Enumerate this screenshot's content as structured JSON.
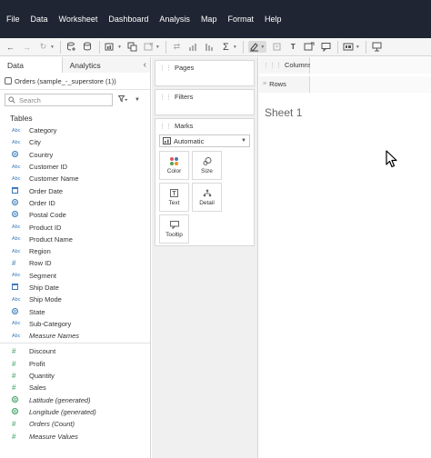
{
  "menu": [
    "File",
    "Data",
    "Worksheet",
    "Dashboard",
    "Analysis",
    "Map",
    "Format",
    "Help"
  ],
  "toolbar_icons": [
    "back-icon",
    "forward-icon",
    "redo-icon",
    "new-datasource-icon",
    "pause-icon",
    "new-worksheet-icon",
    "duplicate-icon",
    "clear-icon",
    "swap-icon",
    "sort-asc-icon",
    "sort-desc-icon",
    "totals-icon",
    "highlight-icon",
    "group-icon",
    "labels-icon",
    "fix-axes-icon",
    "tooltip-icon",
    "fit-icon",
    "show-me-icon",
    "present-icon"
  ],
  "data_pane": {
    "tab_data": "Data",
    "tab_analytics": "Analytics",
    "collapse_glyph": "‹",
    "datasource": "Orders (sample_-_superstore (1))",
    "search_placeholder": "Search",
    "tables_label": "Tables",
    "dimensions": [
      {
        "name": "Category",
        "type": "Abc"
      },
      {
        "name": "City",
        "type": "Abc"
      },
      {
        "name": "Country",
        "type": "globe"
      },
      {
        "name": "Customer ID",
        "type": "Abc"
      },
      {
        "name": "Customer Name",
        "type": "Abc"
      },
      {
        "name": "Order Date",
        "type": "date"
      },
      {
        "name": "Order ID",
        "type": "globe"
      },
      {
        "name": "Postal Code",
        "type": "globe"
      },
      {
        "name": "Product ID",
        "type": "Abc"
      },
      {
        "name": "Product Name",
        "type": "Abc"
      },
      {
        "name": "Region",
        "type": "Abc"
      },
      {
        "name": "Row ID",
        "type": "#"
      },
      {
        "name": "Segment",
        "type": "Abc"
      },
      {
        "name": "Ship Date",
        "type": "date"
      },
      {
        "name": "Ship Mode",
        "type": "Abc"
      },
      {
        "name": "State",
        "type": "globe"
      },
      {
        "name": "Sub-Category",
        "type": "Abc"
      },
      {
        "name": "Measure Names",
        "type": "Abc"
      }
    ],
    "measures": [
      {
        "name": "Discount",
        "type": "#"
      },
      {
        "name": "Profit",
        "type": "#"
      },
      {
        "name": "Quantity",
        "type": "#"
      },
      {
        "name": "Sales",
        "type": "#"
      },
      {
        "name": "Latitude (generated)",
        "type": "globe"
      },
      {
        "name": "Longitude (generated)",
        "type": "globe"
      },
      {
        "name": "Orders (Count)",
        "type": "#"
      },
      {
        "name": "Measure Values",
        "type": "#"
      }
    ]
  },
  "shelves": {
    "pages": "Pages",
    "filters": "Filters",
    "marks": "Marks",
    "mark_type": "Automatic",
    "mark_buttons": [
      "Color",
      "Size",
      "Text",
      "Detail",
      "Tooltip"
    ],
    "columns": "Columns",
    "rows": "Rows"
  },
  "sheet": {
    "title": "Sheet 1"
  },
  "colors": {
    "menubar": "#1f2533",
    "dimension": "#3b7ab8",
    "measure": "#3a9c61"
  }
}
